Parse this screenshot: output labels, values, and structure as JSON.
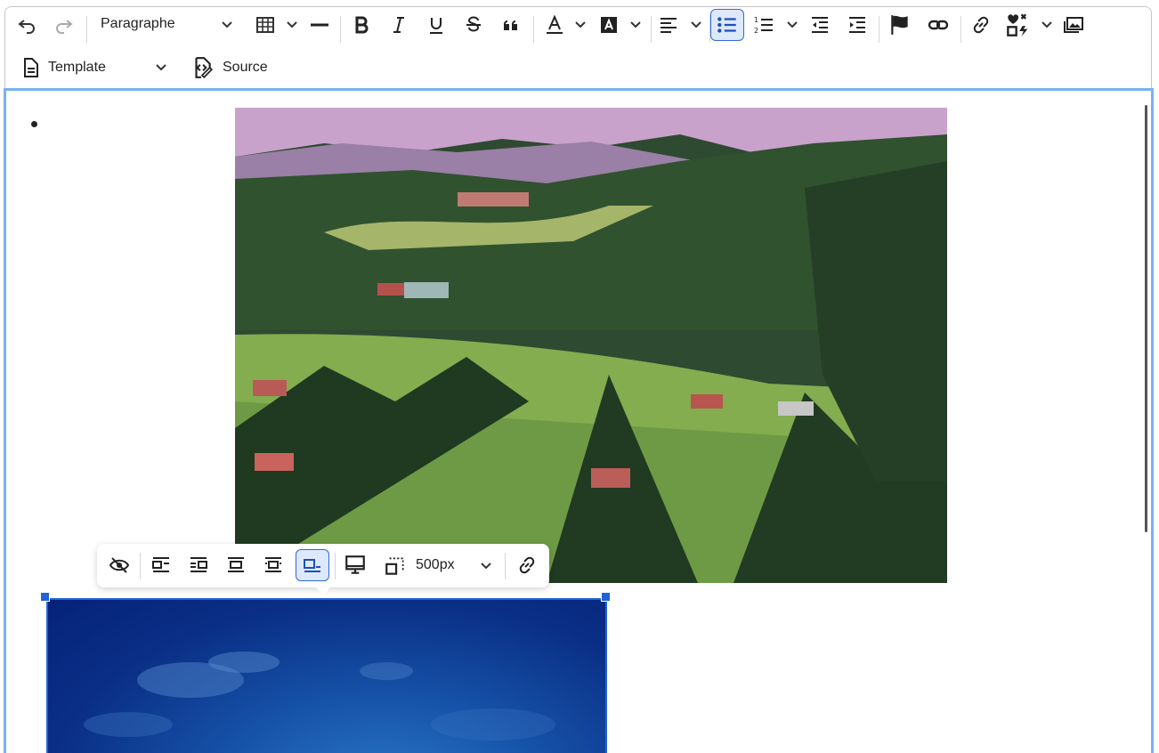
{
  "toolbar": {
    "heading_dropdown": {
      "value": "Paragraphe"
    },
    "template_button": {
      "label": "Template"
    },
    "source_button": {
      "label": "Source"
    },
    "buttons": [
      "undo-icon",
      "redo-icon",
      "table-icon",
      "horizontal-line-icon",
      "bold-icon",
      "italic-icon",
      "underline-icon",
      "strikethrough-icon",
      "blockquote-icon",
      "font-color-icon",
      "font-background-color-icon",
      "align-left-icon",
      "bulleted-list-icon",
      "numbered-list-icon",
      "outdent-icon",
      "indent-icon",
      "flag-icon",
      "link-chain-icon",
      "link-icon",
      "special-characters-icon",
      "image-gallery-icon"
    ],
    "active_button": "bulleted-list-icon"
  },
  "image_toolbar": {
    "size_value": "500px",
    "buttons": [
      "toggle-alt-text-icon",
      "wrap-left-icon",
      "wrap-right-icon",
      "block-center-icon",
      "inline-icon",
      "side-image-icon",
      "image-resize-icon",
      "link-icon"
    ],
    "active_button": "side-image-icon"
  },
  "colors": {
    "focus_border": "#76b2f4",
    "selection": "#2063d9",
    "active_bg": "#dde8fb"
  }
}
